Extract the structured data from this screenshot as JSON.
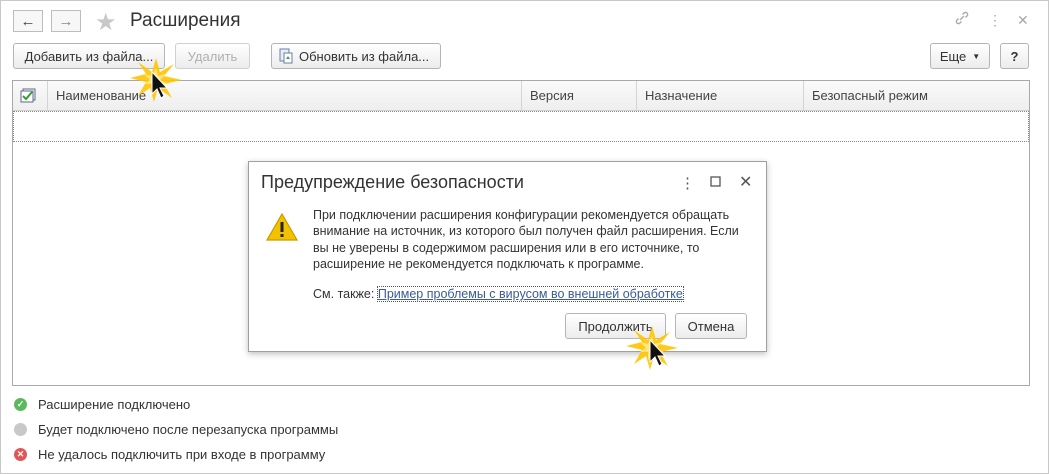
{
  "header": {
    "title": "Расширения",
    "back_icon": "←",
    "forward_icon": "→"
  },
  "toolbar": {
    "add_from_file": "Добавить из файла...",
    "delete": "Удалить",
    "update_from_file": "Обновить из файла...",
    "more": "Еще",
    "help": "?"
  },
  "table": {
    "columns": [
      "Наименование",
      "Версия",
      "Назначение",
      "Безопасный режим"
    ]
  },
  "dialog": {
    "title": "Предупреждение безопасности",
    "message": "При подключении расширения конфигурации рекомендуется обращать внимание на источник, из которого был получен файл расширения. Если вы не уверены в содержимом расширения или в его источнике, то расширение не рекомендуется подключать к программе.",
    "see_also_label": "См. также:",
    "see_also_link": "Пример проблемы с вирусом во внешней обработке",
    "continue": "Продолжить",
    "cancel": "Отмена"
  },
  "legend": [
    {
      "label": "Расширение подключено",
      "color": "#5cb85c"
    },
    {
      "label": "Будет подключено после перезапуска программы",
      "color": "#c8c8c8"
    },
    {
      "label": "Не удалось подключить при входе в программу",
      "color": "#e05555"
    }
  ],
  "colors": {
    "accent_link": "#3a5a9a",
    "warning": "#f2c200"
  }
}
